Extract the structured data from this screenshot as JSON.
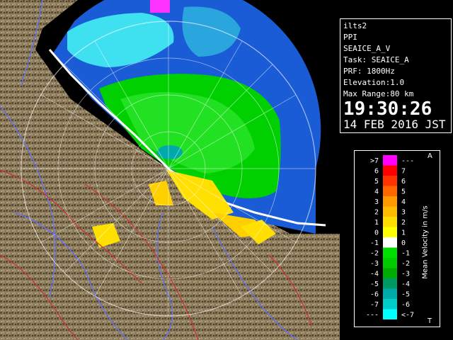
{
  "info": {
    "radar": "ilts2",
    "product": "PPI",
    "product_name": "SEAICE_A_V",
    "task": "Task: SEAICE_A",
    "prf": "PRF: 1800Hz",
    "elevation": "Elevation:1.0",
    "max_range": "Max Range:80 km",
    "time": "19:30:26",
    "date": "14 FEB 2016 JST"
  },
  "legend": {
    "title": "Mean Velocity in m/s",
    "corner_top": "A",
    "corner_bottom": "T",
    "rows": [
      {
        "left": ">7",
        "right": "---",
        "color": "#ff00ff"
      },
      {
        "left": "6",
        "right": "7",
        "color": "#ff0000"
      },
      {
        "left": "5",
        "right": "6",
        "color": "#ff3300"
      },
      {
        "left": "4",
        "right": "5",
        "color": "#ff6600"
      },
      {
        "left": "3",
        "right": "4",
        "color": "#ff9900"
      },
      {
        "left": "2",
        "right": "3",
        "color": "#ffbb00"
      },
      {
        "left": "1",
        "right": "2",
        "color": "#ffdd00"
      },
      {
        "left": "0",
        "right": "1",
        "color": "#ffff00"
      },
      {
        "left": "-1",
        "right": "0",
        "color": "#ffffff"
      },
      {
        "left": "-2",
        "right": "-1",
        "color": "#00e000"
      },
      {
        "left": "-3",
        "right": "-2",
        "color": "#00cc00"
      },
      {
        "left": "-4",
        "right": "-3",
        "color": "#00aa00"
      },
      {
        "left": "-5",
        "right": "-4",
        "color": "#009966"
      },
      {
        "left": "-6",
        "right": "-5",
        "color": "#00aaaa"
      },
      {
        "left": "-7",
        "right": "-6",
        "color": "#00cccc"
      },
      {
        "left": "---",
        "right": "<-7",
        "color": "#00ffff"
      }
    ]
  },
  "map": {
    "colors": {
      "range_disc": "#1a5cd6",
      "terrain": "#8a7a5a",
      "rivers": "#5a6aff",
      "borders": "#cc3333",
      "grid": "#ffffff"
    }
  }
}
